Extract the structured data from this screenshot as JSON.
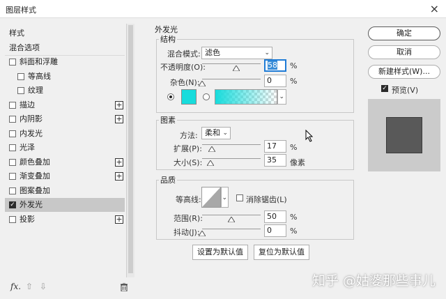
{
  "window": {
    "title": "图层样式",
    "close_glyph": "×"
  },
  "left_panel": {
    "items": [
      {
        "label": "样式",
        "checkbox": false,
        "checked": false,
        "plus": false,
        "indent": false
      },
      {
        "label": "混合选项",
        "checkbox": false,
        "checked": false,
        "plus": false,
        "indent": false
      },
      {
        "label": "斜面和浮雕",
        "checkbox": true,
        "checked": false,
        "plus": false,
        "indent": false
      },
      {
        "label": "等高线",
        "checkbox": true,
        "checked": false,
        "plus": false,
        "indent": true
      },
      {
        "label": "纹理",
        "checkbox": true,
        "checked": false,
        "plus": false,
        "indent": true
      },
      {
        "label": "描边",
        "checkbox": true,
        "checked": false,
        "plus": true,
        "indent": false
      },
      {
        "label": "内阴影",
        "checkbox": true,
        "checked": false,
        "plus": true,
        "indent": false
      },
      {
        "label": "内发光",
        "checkbox": true,
        "checked": false,
        "plus": false,
        "indent": false
      },
      {
        "label": "光泽",
        "checkbox": true,
        "checked": false,
        "plus": false,
        "indent": false
      },
      {
        "label": "颜色叠加",
        "checkbox": true,
        "checked": false,
        "plus": true,
        "indent": false
      },
      {
        "label": "渐变叠加",
        "checkbox": true,
        "checked": false,
        "plus": true,
        "indent": false
      },
      {
        "label": "图案叠加",
        "checkbox": true,
        "checked": false,
        "plus": false,
        "indent": false
      },
      {
        "label": "外发光",
        "checkbox": true,
        "checked": true,
        "plus": false,
        "indent": false,
        "selected": true
      },
      {
        "label": "投影",
        "checkbox": true,
        "checked": false,
        "plus": true,
        "indent": false
      }
    ],
    "bottom": {
      "fx": "fx.",
      "up_glyph": "⇧",
      "down_glyph": "⇩",
      "delete_icon": "trash-icon"
    }
  },
  "outer_glow": {
    "title": "外发光",
    "structure": {
      "title": "结构",
      "blend_mode_label": "混合模式:",
      "blend_mode_value": "滤色",
      "opacity_label": "不透明度(O):",
      "opacity_value": "58",
      "opacity_unit": "%",
      "opacity_level": 58,
      "noise_label": "杂色(N):",
      "noise_value": "0",
      "noise_unit": "%",
      "noise_level": 0,
      "color": "#17dcdc"
    },
    "elements": {
      "title": "图素",
      "method_label": "方法:",
      "method_value": "柔和",
      "spread_label": "扩展(P):",
      "spread_value": "17",
      "spread_unit": "%",
      "spread_level": 17,
      "size_label": "大小(S):",
      "size_value": "35",
      "size_unit": "像素",
      "size_level": 14
    },
    "quality": {
      "title": "品质",
      "contour_label": "等高线:",
      "anti_alias_label": "消除锯齿(L)",
      "anti_alias_checked": false,
      "range_label": "范围(R):",
      "range_value": "50",
      "range_unit": "%",
      "range_level": 50,
      "jitter_label": "抖动(J):",
      "jitter_value": "0",
      "jitter_unit": "%",
      "jitter_level": 0
    },
    "buttons": {
      "make_default": "设置为默认值",
      "reset_default": "复位为默认值"
    }
  },
  "right_panel": {
    "ok": "确定",
    "cancel": "取消",
    "new_style": "新建样式(W)...",
    "preview_label": "预览(V)",
    "preview_checked": true
  },
  "watermark": "知乎 @姑婆那些事儿"
}
